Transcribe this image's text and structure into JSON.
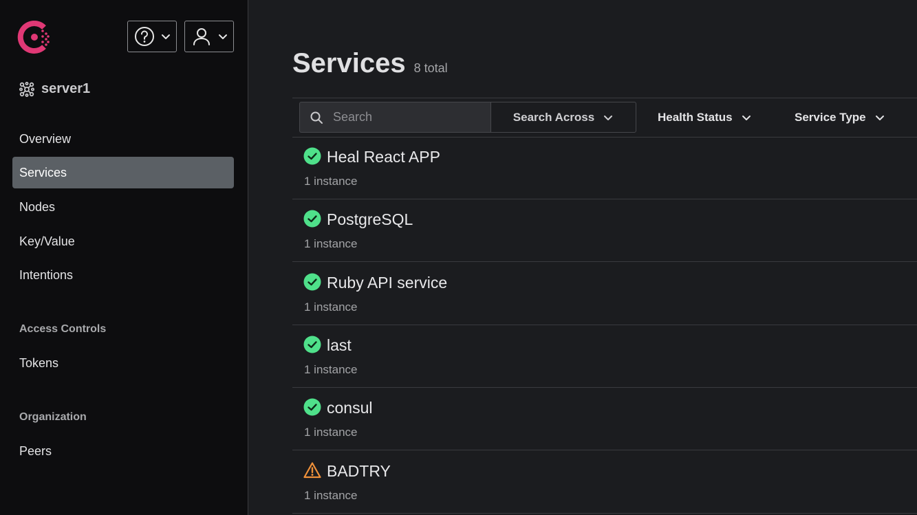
{
  "header": {
    "help_icon": "question-circle-icon",
    "user_icon": "user-icon"
  },
  "datacenter": {
    "label": "server1",
    "icon": "cluster-icon"
  },
  "nav": {
    "items": [
      {
        "label": "Overview"
      },
      {
        "label": "Services",
        "active": true
      },
      {
        "label": "Nodes"
      },
      {
        "label": "Key/Value"
      },
      {
        "label": "Intentions"
      }
    ],
    "access_controls": {
      "heading": "Access Controls",
      "items": [
        {
          "label": "Tokens"
        }
      ]
    },
    "organization": {
      "heading": "Organization",
      "items": [
        {
          "label": "Peers"
        }
      ]
    }
  },
  "main": {
    "title": "Services",
    "total": "8 total",
    "search": {
      "placeholder": "Search",
      "value": ""
    },
    "filters": {
      "search_across": "Search Across",
      "health_status": "Health Status",
      "service_type": "Service Type"
    },
    "services": [
      {
        "name": "Heal React APP",
        "instances": "1 instance",
        "status": "passing"
      },
      {
        "name": "PostgreSQL",
        "instances": "1 instance",
        "status": "passing"
      },
      {
        "name": "Ruby API service",
        "instances": "1 instance",
        "status": "passing"
      },
      {
        "name": "last",
        "instances": "1 instance",
        "status": "passing"
      },
      {
        "name": "consul",
        "instances": "1 instance",
        "status": "passing"
      },
      {
        "name": "BADTRY",
        "instances": "1 instance",
        "status": "warning"
      }
    ]
  },
  "colors": {
    "brand": "#e03875",
    "passing": "#4fe08a",
    "warning": "#f0913a",
    "active_nav": "#5b6065"
  }
}
